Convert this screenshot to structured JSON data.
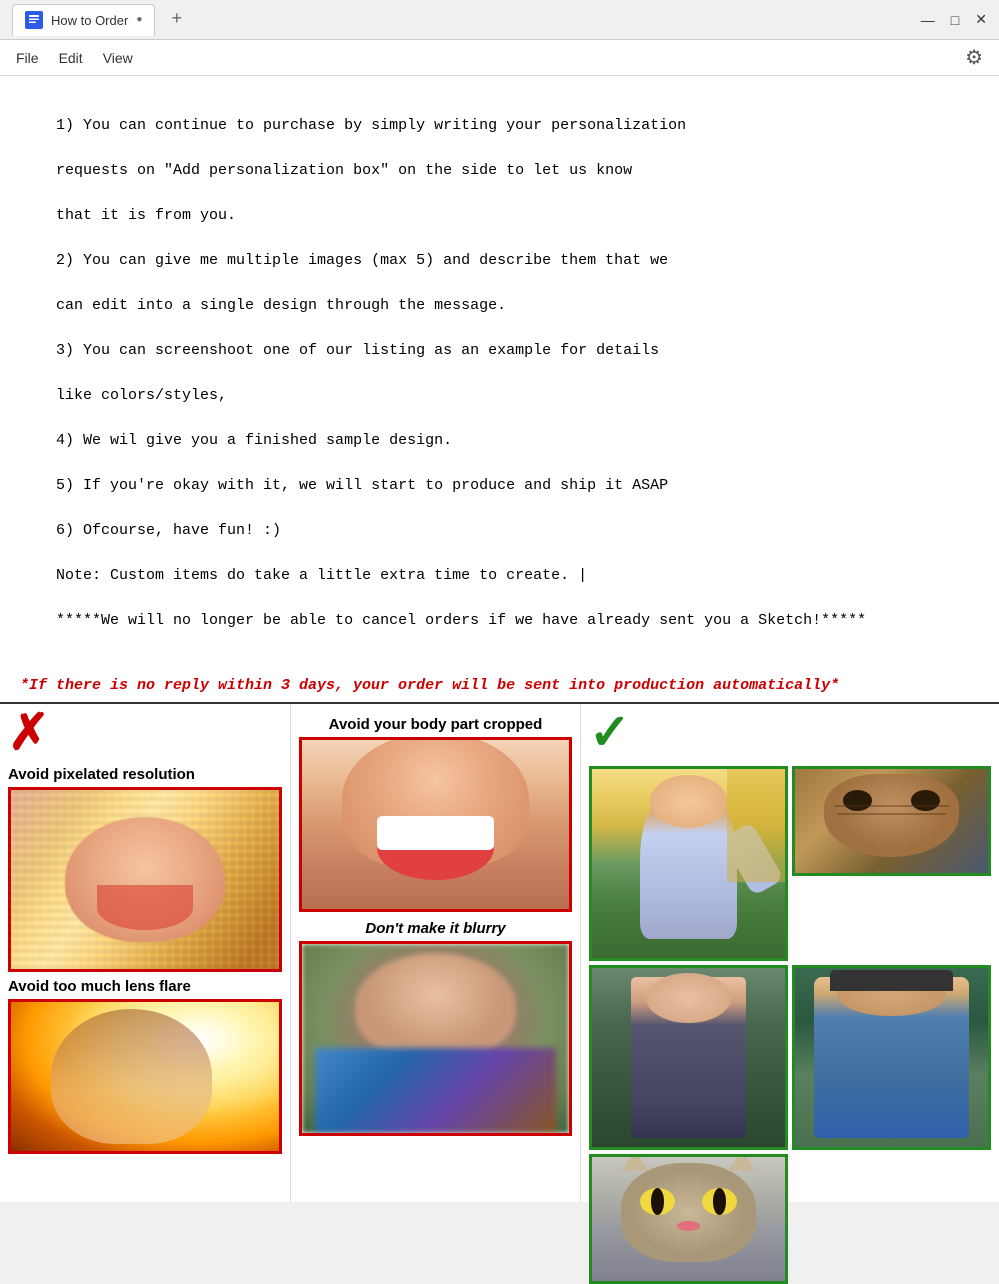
{
  "titlebar": {
    "title": "How to Order",
    "tab_dot": "●",
    "tab_plus": "+",
    "win_minimize": "—",
    "win_maximize": "□",
    "win_close": "✕"
  },
  "menubar": {
    "file": "File",
    "edit": "Edit",
    "view": "View"
  },
  "document": {
    "line1": "1) You can continue to purchase by simply writing your personalization",
    "line2": "requests on \"Add personalization box\" on the side to let us know",
    "line3": "that it is from you.",
    "line4": "2) You can give me multiple images (max 5) and describe them that we",
    "line5": "can edit into a single design through the message.",
    "line6": "3) You can screenshoot one of our listing as an example for details",
    "line7": "like colors/styles,",
    "line8": "4) We wil give you a finished sample design.",
    "line9": "5) If you're okay with it, we will start to produce and ship it ASAP",
    "line10": "6) Ofcourse, have fun! :)",
    "line11": "Note: Custom items do take a little extra time to create. |",
    "line12": "*****We will no longer be able to cancel orders if we have already sent you a Sketch!*****",
    "red_line": "*If there is no reply within 3 days, your order will be sent into production automatically*"
  },
  "bad_section": {
    "x_mark": "✗",
    "label_pixelated": "Avoid pixelated resolution",
    "label_lens_flare": "Avoid too much lens flare",
    "label_cropped": "Avoid your body part cropped",
    "label_blurry": "Don't make it blurry"
  },
  "good_section": {
    "check_mark": "✓"
  }
}
